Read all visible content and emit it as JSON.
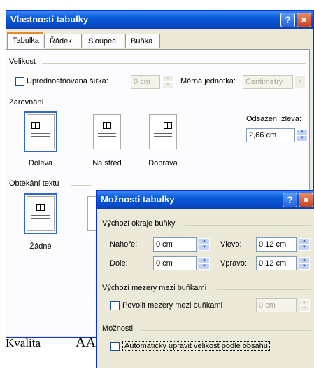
{
  "document": {
    "cell1": "Kvalita",
    "cell2": "AA"
  },
  "main_dialog": {
    "title": "Vlastnosti tabulky",
    "help_glyph": "?",
    "close_glyph": "×",
    "tabs": [
      "Tabulka",
      "Řádek",
      "Sloupec",
      "Buňka"
    ],
    "size": {
      "group": "Velikost",
      "preferred_width_label": "Upřednostňovaná šířka:",
      "preferred_width_value": "0 cm",
      "unit_label": "Měrná jednotka:",
      "unit_value": "Centimetry"
    },
    "alignment": {
      "group": "Zarovnání",
      "options": [
        "Doleva",
        "Na střed",
        "Doprava"
      ],
      "indent_label": "Odsazení zleva:",
      "indent_value": "2,66 cm"
    },
    "wrapping": {
      "group": "Obtékání textu",
      "options": [
        "Žádné"
      ]
    }
  },
  "options_dialog": {
    "title": "Možnosti tabulky",
    "help_glyph": "?",
    "close_glyph": "×",
    "margins": {
      "group": "Výchozí okraje buňky",
      "top_label": "Nahoře:",
      "top_value": "0 cm",
      "left_label": "Vlevo:",
      "left_value": "0,12 cm",
      "bottom_label": "Dole:",
      "bottom_value": "0 cm",
      "right_label": "Vpravo:",
      "right_value": "0,12 cm"
    },
    "spacing": {
      "group": "Výchozí mezery mezi buňkami",
      "allow_label": "Povolit mezery mezi buňkami",
      "allow_value": "0 cm"
    },
    "options": {
      "group": "Možnosti",
      "autofit_label": "Automaticky upravit velikost podle obsahu"
    }
  }
}
